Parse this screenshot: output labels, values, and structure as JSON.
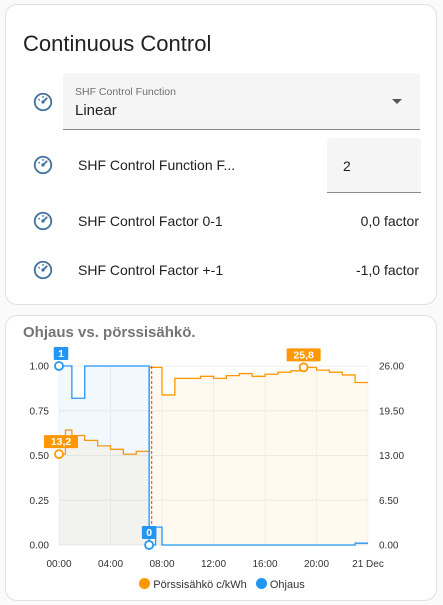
{
  "card": {
    "title": "Continuous Control",
    "select": {
      "label": "SHF Control Function",
      "value": "Linear",
      "icon": "gauge-icon"
    },
    "rows": [
      {
        "label": "SHF Control Function F...",
        "value": "2",
        "type": "number-input",
        "icon": "gauge-icon"
      },
      {
        "label": "SHF Control Factor 0-1",
        "value": "0,0 factor",
        "type": "sensor",
        "icon": "gauge-icon"
      },
      {
        "label": "SHF Control Factor +-1",
        "value": "-1,0 factor",
        "type": "sensor",
        "icon": "gauge-icon"
      }
    ]
  },
  "chart_card": {
    "title": "Ohjaus vs. pörssisähkö.",
    "legend": [
      {
        "name": "Pörssisähkö c/kWh",
        "color": "#ff9800"
      },
      {
        "name": "Ohjaus",
        "color": "#2196f3"
      }
    ]
  },
  "chart_data": {
    "type": "line",
    "x_ticks": [
      "00:00",
      "04:00",
      "08:00",
      "12:00",
      "16:00",
      "20:00",
      "21 Dec"
    ],
    "y_left_ticks": [
      "0.00",
      "0.25",
      "0.50",
      "0.75",
      "1.00"
    ],
    "y_left_range": [
      0,
      1
    ],
    "y_right_ticks": [
      "0.00",
      "6.50",
      "13.00",
      "19.50",
      "26.00"
    ],
    "y_right_range": [
      0,
      26
    ],
    "x_range_hours": [
      0,
      24
    ],
    "series": [
      {
        "name": "Pörssisähkö c/kWh",
        "color": "#ff9800",
        "axis": "right",
        "x": [
          0,
          0.5,
          1,
          2,
          3,
          4,
          5,
          6,
          7,
          8,
          9,
          10,
          11,
          12,
          13,
          14,
          15,
          16,
          17,
          18,
          19,
          20,
          21,
          22,
          23,
          23.5
        ],
        "y": [
          13.2,
          16.7,
          15.9,
          15.2,
          14.4,
          13.9,
          13.2,
          13.6,
          25.8,
          21.8,
          24.2,
          24.2,
          24.5,
          24.2,
          24.6,
          24.9,
          24.5,
          24.8,
          25.1,
          25.3,
          25.8,
          25.4,
          25.1,
          24.7,
          23.6,
          23.6
        ]
      },
      {
        "name": "Ohjaus",
        "color": "#2196f3",
        "axis": "left",
        "x": [
          0,
          1,
          2,
          3,
          4,
          5,
          6,
          7,
          7.5,
          8,
          9,
          10,
          11,
          12,
          13,
          14,
          15,
          16,
          17,
          18,
          19,
          20,
          21,
          22,
          23,
          23.5
        ],
        "y": [
          1,
          0.82,
          1,
          1,
          1,
          1,
          1,
          0,
          0.1,
          0,
          0,
          0,
          0,
          0,
          0,
          0,
          0,
          0,
          0,
          0,
          0,
          0,
          0,
          0,
          0.01,
          0.01
        ]
      }
    ],
    "annotations": [
      {
        "label": "1",
        "series": "Ohjaus",
        "x": 0,
        "y": 1
      },
      {
        "label": "0",
        "series": "Ohjaus",
        "x": 7,
        "y": 0
      },
      {
        "label": "13,2",
        "series": "Pörssisähkö c/kWh",
        "x": 0,
        "y": 13.2
      },
      {
        "label": "25,8",
        "series": "Pörssisähkö c/kWh",
        "x": 19,
        "y": 25.8
      }
    ],
    "now_marker_hour": 7.2
  }
}
